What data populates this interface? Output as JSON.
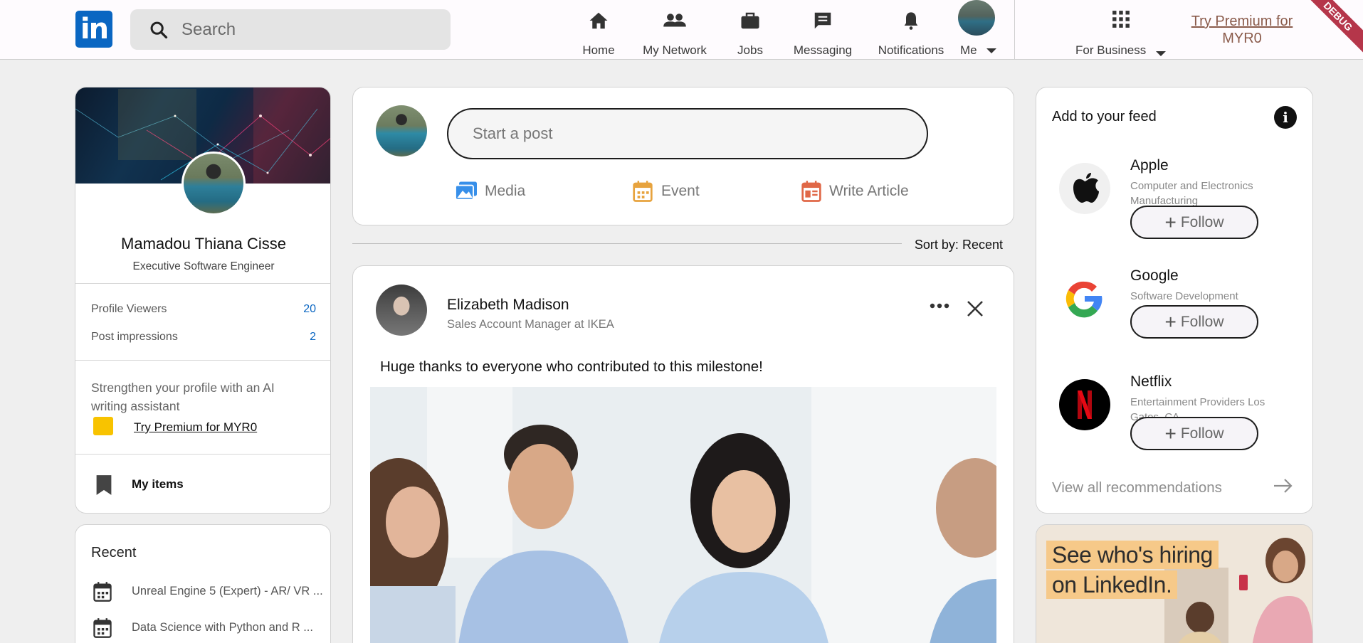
{
  "header": {
    "logo_text": "in",
    "search_placeholder": "Search",
    "nav": [
      {
        "label": "Home",
        "icon": "home-icon"
      },
      {
        "label": "My Network",
        "icon": "people-icon"
      },
      {
        "label": "Jobs",
        "icon": "briefcase-icon"
      },
      {
        "label": "Messaging",
        "icon": "message-icon"
      },
      {
        "label": "Notifications",
        "icon": "bell-icon"
      }
    ],
    "me_label": "Me",
    "for_business_label": "For Business",
    "premium_line1": "Try Premium for",
    "premium_line2": "MYR0",
    "debug_label": "DEBUG"
  },
  "profile": {
    "name": "Mamadou Thiana Cisse",
    "title": "Executive Software Engineer",
    "stats": [
      {
        "label": "Profile Viewers",
        "value": "20"
      },
      {
        "label": "Post impressions",
        "value": "2"
      }
    ],
    "strengthen_text": "Strengthen your profile with an AI writing assistant",
    "premium_link": "Try Premium for MYR0",
    "my_items": "My items"
  },
  "recent": {
    "title": "Recent",
    "items": [
      "Unreal Engine 5 (Expert) - AR/ VR ...",
      "Data Science with Python and R ..."
    ]
  },
  "composer": {
    "placeholder": "Start a post",
    "tools": [
      {
        "label": "Media",
        "color": "#378fe9"
      },
      {
        "label": "Event",
        "color": "#e7a33e"
      },
      {
        "label": "Write Article",
        "color": "#e06847"
      }
    ]
  },
  "sort": {
    "label": "Sort by:",
    "value": "Recent"
  },
  "post": {
    "author": "Elizabeth Madison",
    "subtitle": "Sales Account Manager at IKEA",
    "text": "Huge thanks to everyone who contributed to this milestone!"
  },
  "feed": {
    "title": "Add to your feed",
    "companies": [
      {
        "name": "Apple",
        "description": "Computer and Electronics Manufacturing",
        "follow": "Follow"
      },
      {
        "name": "Google",
        "description": "Software Development",
        "follow": "Follow"
      },
      {
        "name": "Netflix",
        "description": "Entertainment Providers Los Gatos, CA",
        "follow": "Follow"
      }
    ],
    "view_all": "View all recommendations"
  },
  "ad": {
    "line1": "See who's hiring",
    "line2": "on LinkedIn."
  },
  "colors": {
    "brand": "#0a66c2",
    "premium_gold": "#f8c300",
    "stat_value": "#0a66c2"
  }
}
